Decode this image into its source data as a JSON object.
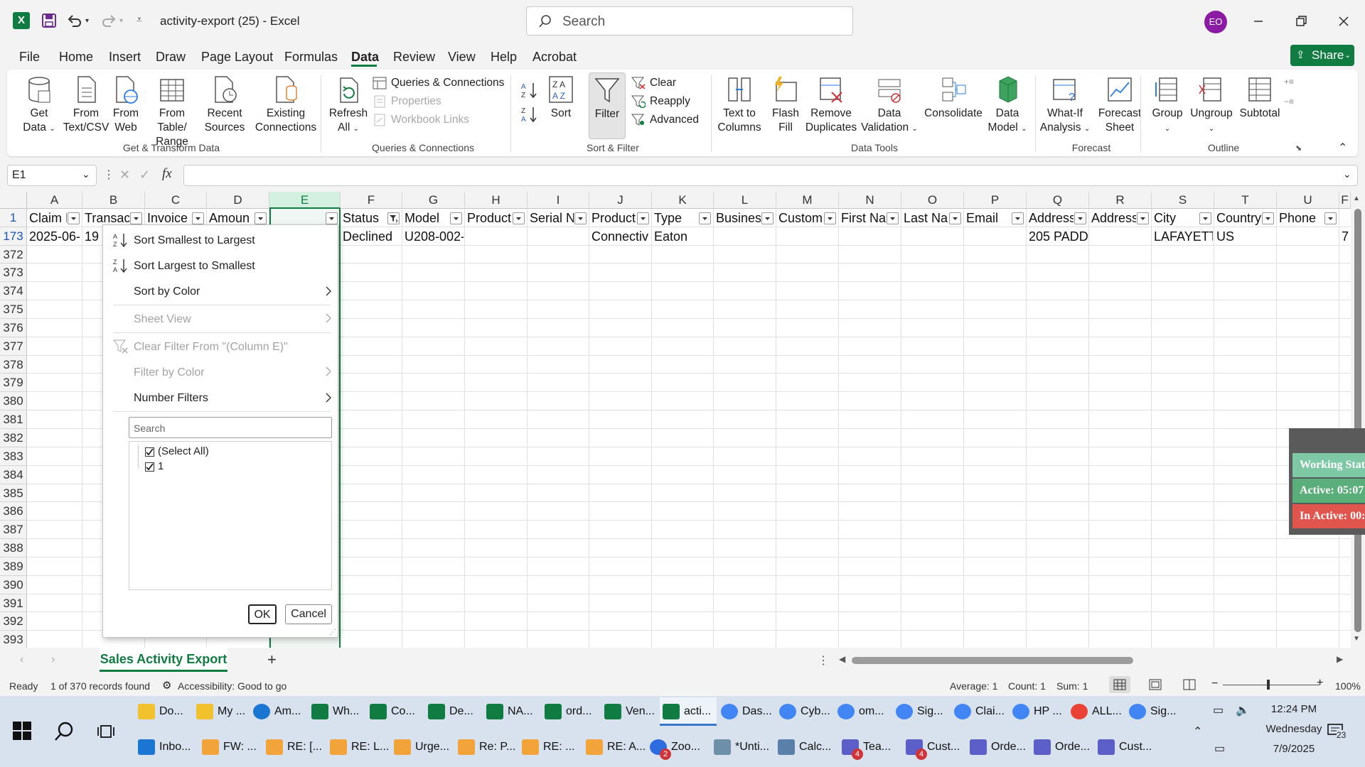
{
  "titlebar": {
    "doc_title": "activity-export (25)  -  Excel",
    "search_placeholder": "Search",
    "avatar_initials": "EO"
  },
  "menu": [
    "File",
    "Home",
    "Insert",
    "Draw",
    "Page Layout",
    "Formulas",
    "Data",
    "Review",
    "View",
    "Help",
    "Acrobat"
  ],
  "share_label": "Share",
  "ribbon": {
    "get_data": "Get Data",
    "from_text_csv": "From Text/CSV",
    "from_web": "From Web",
    "from_table_range": "From Table/ Range",
    "recent_sources": "Recent Sources",
    "existing_connections": "Existing Connections",
    "group_get_transform": "Get & Transform Data",
    "refresh_all": "Refresh All",
    "queries_connections": "Queries & Connections",
    "properties": "Properties",
    "workbook_links": "Workbook Links",
    "group_queries": "Queries & Connections",
    "sort": "Sort",
    "filter": "Filter",
    "clear": "Clear",
    "reapply": "Reapply",
    "advanced": "Advanced",
    "group_sort_filter": "Sort & Filter",
    "text_to_columns": "Text to Columns",
    "flash_fill": "Flash Fill",
    "remove_duplicates": "Remove Duplicates",
    "data_validation": "Data Validation",
    "consolidate": "Consolidate",
    "data_model": "Data Model",
    "group_data_tools": "Data Tools",
    "what_if": "What-If Analysis",
    "forecast_sheet": "Forecast Sheet",
    "group_forecast": "Forecast",
    "group": "Group",
    "ungroup": "Ungroup",
    "subtotal": "Subtotal",
    "group_outline": "Outline"
  },
  "namebox": "E1",
  "fx": "fx",
  "columns": [
    "A",
    "B",
    "C",
    "D",
    "E",
    "F",
    "G",
    "H",
    "I",
    "J",
    "K",
    "L",
    "M",
    "N",
    "O",
    "P",
    "Q",
    "R",
    "S",
    "T",
    "U"
  ],
  "header_row": [
    "Claim D",
    "Transac",
    "Invoice",
    "Amoun",
    "",
    "Status",
    "Model",
    "Product",
    "Serial N",
    "Product",
    "Type",
    "Busines",
    "Custom",
    "First Na",
    "Last Na",
    "Email",
    "Address",
    "Address",
    "City",
    "Country",
    "Phone"
  ],
  "data_row": {
    "A": "2025-06-1",
    "B": "19",
    "F": "Declined",
    "G": "U208-002-",
    "J": "Connectiv",
    "K": "Eaton",
    "Q": "205 PADDI",
    "S": "LAFAYETTI",
    "T": "US",
    "U_partial": "7"
  },
  "row_numbers": [
    "1",
    "173",
    "372",
    "373",
    "374",
    "375",
    "376",
    "377",
    "378",
    "379",
    "380",
    "381",
    "382",
    "383",
    "384",
    "385",
    "386",
    "387",
    "388",
    "389",
    "390",
    "391",
    "392",
    "393"
  ],
  "extra_col_hdr": "F",
  "dropdown": {
    "sort_asc": "Sort Smallest to Largest",
    "sort_desc": "Sort Largest to Smallest",
    "sort_by_color": "Sort by Color",
    "sheet_view": "Sheet View",
    "clear_filter": "Clear Filter From \"(Column E)\"",
    "filter_by_color": "Filter by Color",
    "number_filters": "Number Filters",
    "search_placeholder": "Search",
    "select_all": "(Select All)",
    "item_1": "1",
    "ok": "OK",
    "cancel": "Cancel"
  },
  "widget": {
    "working": "Working Stat",
    "active": "Active: 05:07",
    "inactive": "In Active: 00:"
  },
  "sheet_tab": "Sales Activity Export",
  "status": {
    "ready": "Ready",
    "records": "1 of 370 records found",
    "accessibility": "Accessibility: Good to go",
    "average": "Average: 1",
    "count": "Count: 1",
    "sum": "Sum: 1",
    "zoom": "100%"
  },
  "taskbar": {
    "row1": [
      "Do...",
      "My ...",
      "Am...",
      "Wh...",
      "Co...",
      "De...",
      "NA...",
      "ord...",
      "Ven...",
      "acti...",
      "Das...",
      "Cyb...",
      "om...",
      "Sig...",
      "Clai...",
      "HP ...",
      "ALL...",
      "Sig..."
    ],
    "row2": [
      "Inbo...",
      "FW: ...",
      "RE: [...",
      "RE: L...",
      "Urge...",
      "Re: P...",
      "RE: ...",
      "RE: A...",
      "Zoo...",
      "*Unti...",
      "Calc...",
      "Tea...",
      "Cust...",
      "Orde...",
      "Orde...",
      "Cust..."
    ],
    "badges": {
      "zoom": "2",
      "teams1": "4",
      "teams2": "4"
    },
    "time": "12:24 PM",
    "day": "Wednesday",
    "date": "7/9/2025",
    "notif": "23"
  },
  "colors": {
    "excel_green": "#107c41",
    "avatar": "#8b1aa5",
    "widget_green": "#5aae7a",
    "widget_red": "#e0564f"
  }
}
